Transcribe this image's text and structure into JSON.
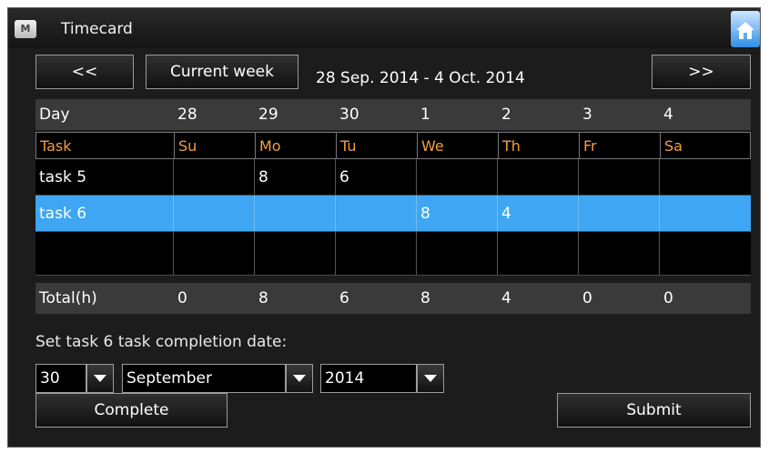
{
  "window": {
    "title": "Timecard",
    "app_icon_glyph": "M"
  },
  "nav": {
    "prev_label": "<<",
    "current_week_label": "Current week",
    "date_range": "28 Sep. 2014 - 4 Oct. 2014",
    "next_label": ">>"
  },
  "grid": {
    "day_label": "Day",
    "dates": [
      "28",
      "29",
      "30",
      "1",
      "2",
      "3",
      "4"
    ],
    "task_header": "Task",
    "weekdays": [
      "Su",
      "Mo",
      "Tu",
      "We",
      "Th",
      "Fr",
      "Sa"
    ],
    "rows": [
      {
        "task": "task 5",
        "hours": [
          "",
          "8",
          "6",
          "",
          "",
          "",
          ""
        ],
        "selected": false
      },
      {
        "task": "task 6",
        "hours": [
          "",
          "",
          "",
          "8",
          "4",
          "",
          ""
        ],
        "selected": true
      },
      {
        "task": "",
        "hours": [
          "",
          "",
          "",
          "",
          "",
          "",
          ""
        ],
        "selected": false
      }
    ],
    "total_label": "Total(h)",
    "totals": [
      "0",
      "8",
      "6",
      "8",
      "4",
      "0",
      "0"
    ]
  },
  "completion": {
    "prompt": "Set task 6 task completion date:",
    "day_value": "30",
    "month_value": "September",
    "year_value": "2014"
  },
  "actions": {
    "complete_label": "Complete",
    "submit_label": "Submit"
  },
  "colors": {
    "header_text": "#f0a040",
    "selected_row": "#3ea6f2",
    "home_icon": "#2f8fe6"
  }
}
